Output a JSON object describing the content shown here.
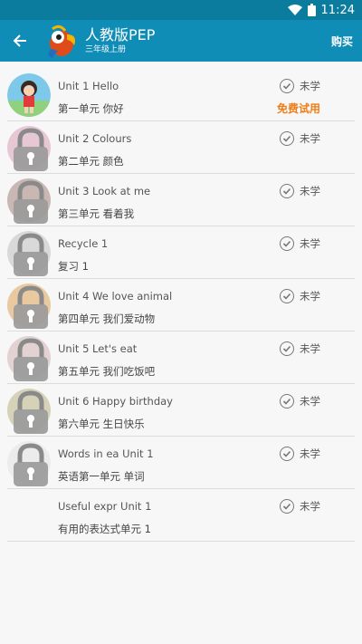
{
  "statusbar": {
    "time": "11:24"
  },
  "header": {
    "title": "人教版PEP",
    "subtitle": "三年级上册",
    "buy_label": "购买"
  },
  "status_label": "未学",
  "trial_label": "免费试用",
  "units": [
    {
      "name": "Unit 1 Hello",
      "cn": "第一单元 你好",
      "thumb": "girl-avatar",
      "locked": false,
      "trial": true
    },
    {
      "name": "Unit 2 Colours",
      "cn": "第二单元 颜色",
      "thumb": "lock",
      "locked": true,
      "tint": "#e8c7d4"
    },
    {
      "name": "Unit 3 Look at me",
      "cn": "第三单元 看着我",
      "thumb": "lock",
      "locked": true,
      "tint": "#c9b7b3"
    },
    {
      "name": "Recycle 1",
      "cn": "复习 1",
      "thumb": "lock",
      "locked": true,
      "tint": "#d9d9d9"
    },
    {
      "name": "Unit 4 We love animal",
      "cn": "第四单元 我们爱动物",
      "thumb": "lock",
      "locked": true,
      "tint": "#e9c9a0"
    },
    {
      "name": "Unit 5 Let's eat",
      "cn": "第五单元 我们吃饭吧",
      "thumb": "lock",
      "locked": true,
      "tint": "#e2d2d2"
    },
    {
      "name": "Unit 6 Happy birthday",
      "cn": "第六单元 生日快乐",
      "thumb": "lock",
      "locked": true,
      "tint": "#d6d2b8"
    },
    {
      "name": "Words in ea Unit 1",
      "cn": "英语第一单元 单词",
      "thumb": "lock",
      "locked": true,
      "tint": "#ececec"
    },
    {
      "name": "Useful expr Unit 1",
      "cn": "有用的表达式单元 1",
      "thumb": "none",
      "locked": false
    }
  ],
  "icons": {
    "back": "arrow-left-icon",
    "logo": "parrot-logo",
    "status": "check-circle-icon",
    "wifi": "wifi-icon",
    "battery": "battery-icon"
  },
  "colors": {
    "statusbar": "#0b7c9e",
    "appbar": "#0f8db6",
    "trial": "#f07d18"
  }
}
